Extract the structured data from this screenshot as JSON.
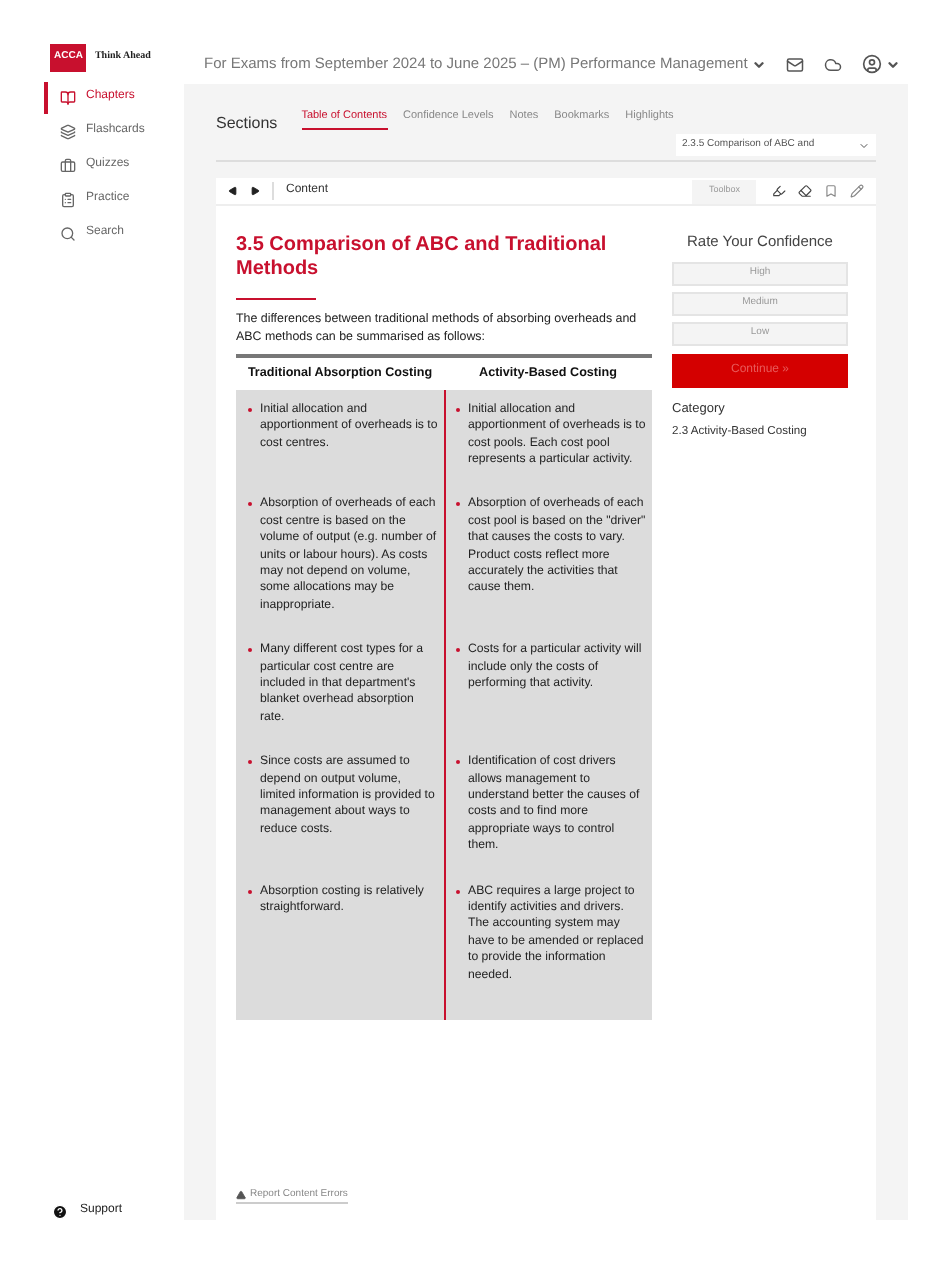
{
  "logo": {
    "mark": "ACCA",
    "tagline": "Think Ahead"
  },
  "sidebar": {
    "items": [
      {
        "label": "Chapters",
        "selected": true
      },
      {
        "label": "Flashcards",
        "selected": false
      },
      {
        "label": "Quizzes",
        "selected": false
      },
      {
        "label": "Practice",
        "selected": false
      },
      {
        "label": "Search",
        "selected": false
      }
    ],
    "support": "Support"
  },
  "header": {
    "title": "For Exams from September 2024 to June 2025 – (PM) Performance Management"
  },
  "sections": {
    "label": "Sections",
    "tabs": [
      {
        "label": "Table of Contents",
        "selected": true
      },
      {
        "label": "Confidence Levels",
        "selected": false
      },
      {
        "label": "Notes",
        "selected": false
      },
      {
        "label": "Bookmarks",
        "selected": false
      },
      {
        "label": "Highlights",
        "selected": false
      }
    ],
    "select": "2.3.5 Comparison of ABC and"
  },
  "content_bar": {
    "label": "Content",
    "toolbox": "Toolbox"
  },
  "article": {
    "title": "3.5 Comparison of ABC and Traditional Methods",
    "intro": "The differences between traditional methods of absorbing overheads and ABC methods can be summarised as follows:",
    "table": {
      "columns": [
        "Traditional Absorption Costing",
        "Activity-Based Costing"
      ],
      "rows": [
        [
          "Initial allocation and apportionment of overheads is to cost centres.",
          "Initial allocation and apportionment of overheads is to cost pools. Each cost pool represents a particular activity."
        ],
        [
          "Absorption of overheads of each cost centre is based on the volume of output (e.g. number of units or labour hours). As costs may not depend on volume, some allocations may be inappropriate.",
          "Absorption of overheads of each cost pool is based on the \"driver\" that causes the costs to vary. Product costs reflect more accurately the activities that cause them."
        ],
        [
          "Many different cost types for a particular cost centre are included in that department's blanket overhead absorption rate.",
          "Costs for a particular activity will include only the costs of performing that activity."
        ],
        [
          "Since costs are assumed to depend on output volume, limited information is provided to management about ways to reduce costs.",
          "Identification of cost drivers allows management to understand better the causes of costs and to find more appropriate ways to control them."
        ],
        [
          "Absorption costing is relatively straightforward.",
          "ABC requires a large project to identify activities and drivers. The accounting system may have to be amended or replaced to provide the information needed."
        ]
      ]
    },
    "report": "Report Content Errors"
  },
  "confidence": {
    "title": "Rate Your Confidence",
    "options": [
      {
        "label": "High",
        "selected": false
      },
      {
        "label": "Medium",
        "selected": false
      },
      {
        "label": "Low",
        "selected": false
      }
    ],
    "continue": {
      "label": "Continue »",
      "disabled": true
    },
    "category_label": "Category",
    "category": "2.3 Activity-Based Costing"
  }
}
